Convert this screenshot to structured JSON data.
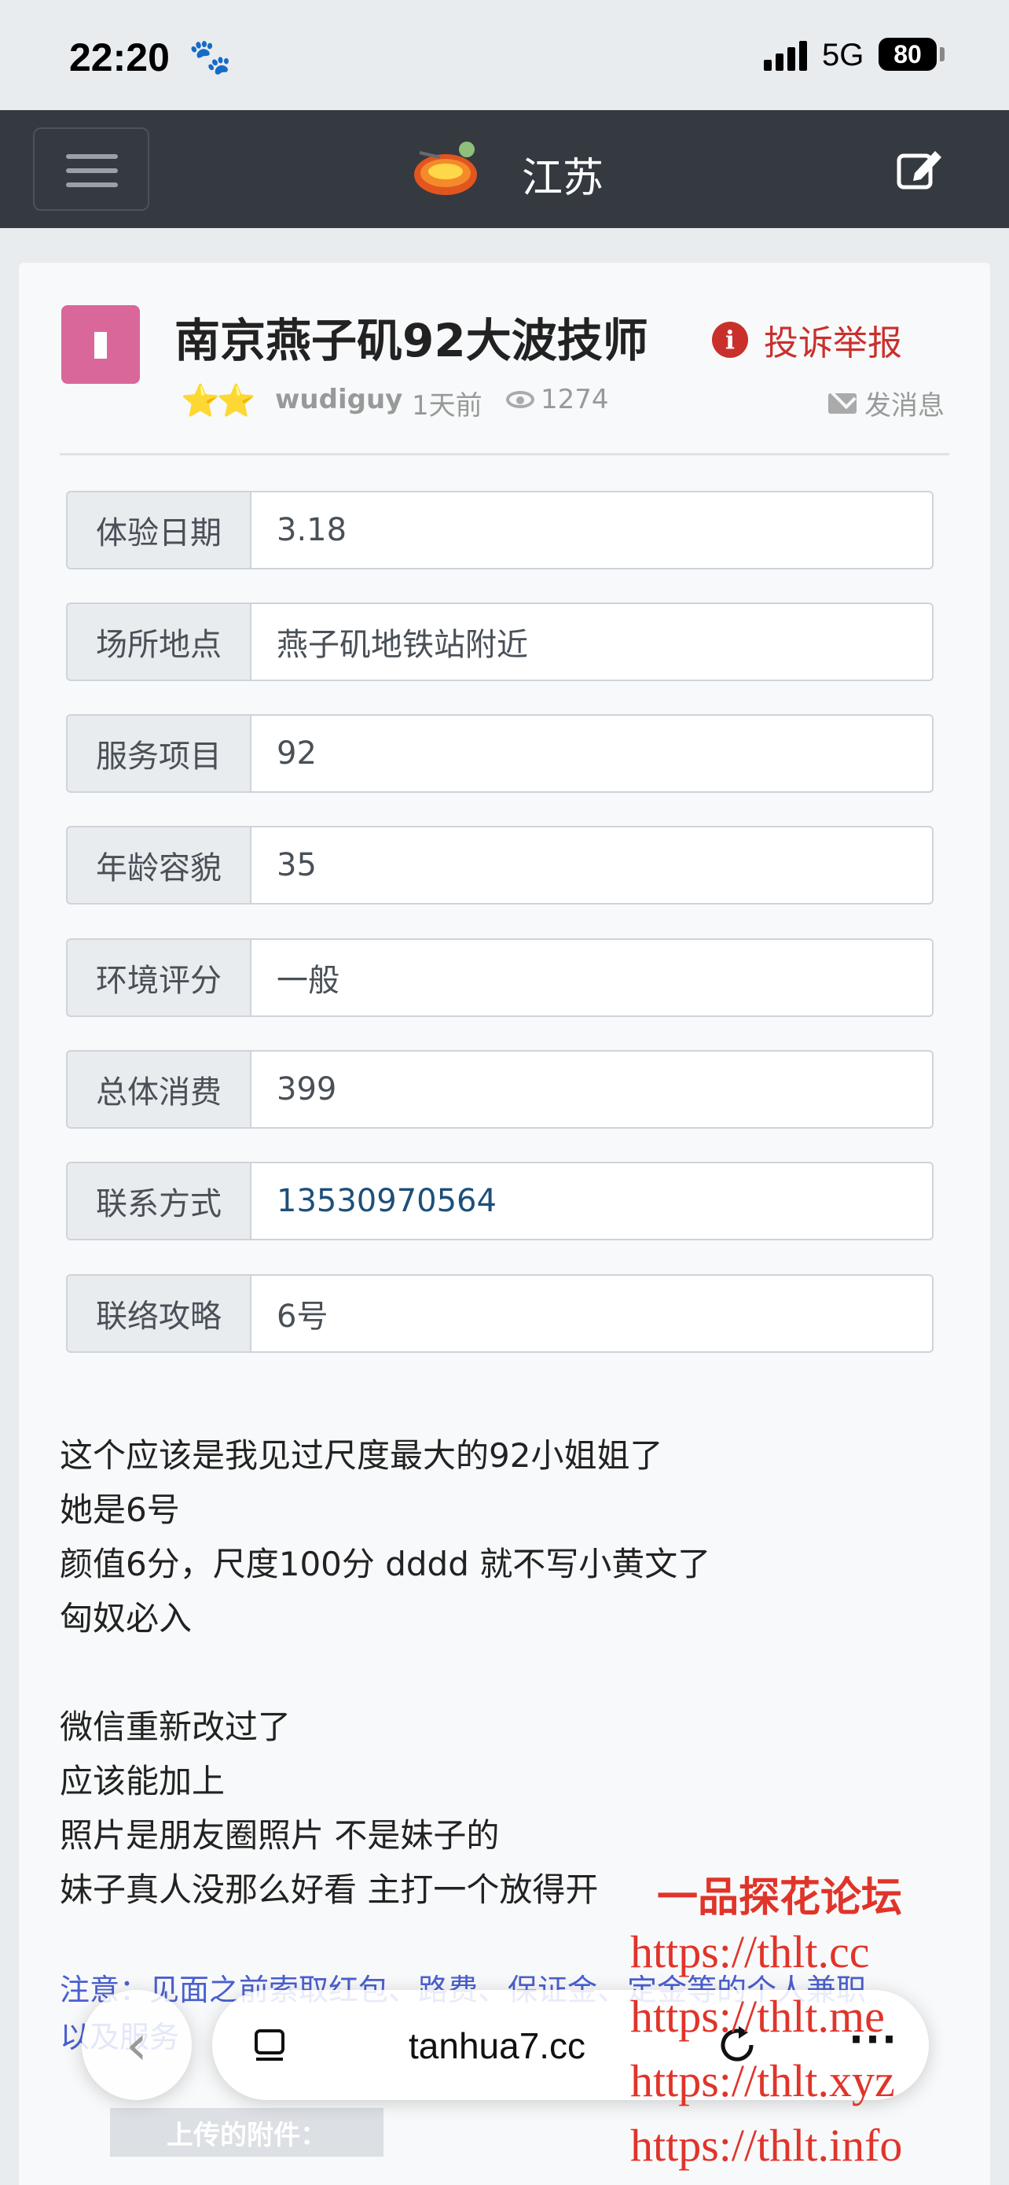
{
  "status_bar": {
    "time": "22:20",
    "network": "5G",
    "battery": "80"
  },
  "navbar": {
    "title": "江苏"
  },
  "post": {
    "title": "南京燕子矶92大波技师",
    "report_label": "投诉举报",
    "stars": "⭐⭐",
    "author": "wudiguy",
    "time": "1天前",
    "views": "1274",
    "message_label": "发消息"
  },
  "fields": [
    {
      "label": "体验日期",
      "value": "3.18"
    },
    {
      "label": "场所地点",
      "value": "燕子矶地铁站附近"
    },
    {
      "label": "服务项目",
      "value": "92"
    },
    {
      "label": "年龄容貌",
      "value": "35"
    },
    {
      "label": "环境评分",
      "value": "一般"
    },
    {
      "label": "总体消费",
      "value": "399"
    },
    {
      "label": "联系方式",
      "value": "13530970564"
    },
    {
      "label": "联络攻略",
      "value": "6号"
    }
  ],
  "body_lines": [
    "这个应该是我见过尺度最大的92小姐姐了",
    "她是6号",
    "颜值6分，尺度100分  dddd 就不写小黄文了",
    "匈奴必入",
    "",
    "微信重新改过了",
    "应该能加上",
    "照片是朋友圈照片 不是妹子的",
    "妹子真人没那么好看  主打一个放得开"
  ],
  "notice": {
    "line1": "注意：见面之前索取红包、路费、保证金、定金等的个人兼职",
    "line2": "以及服务"
  },
  "attachments_label": "上传的附件：",
  "browser": {
    "url": "tanhua7.cc"
  },
  "watermark": {
    "title": "一品探花论坛",
    "urls": [
      "https://thlt.cc",
      "https://thlt.me",
      "https://thlt.xyz",
      "https://thlt.info"
    ]
  },
  "colors": {
    "navbar_bg": "#343a40",
    "avatar": "#d9679a",
    "report": "#c9302c",
    "link": "#1d4f7a",
    "notice": "#4a5fcf",
    "watermark": "#e0342a"
  }
}
